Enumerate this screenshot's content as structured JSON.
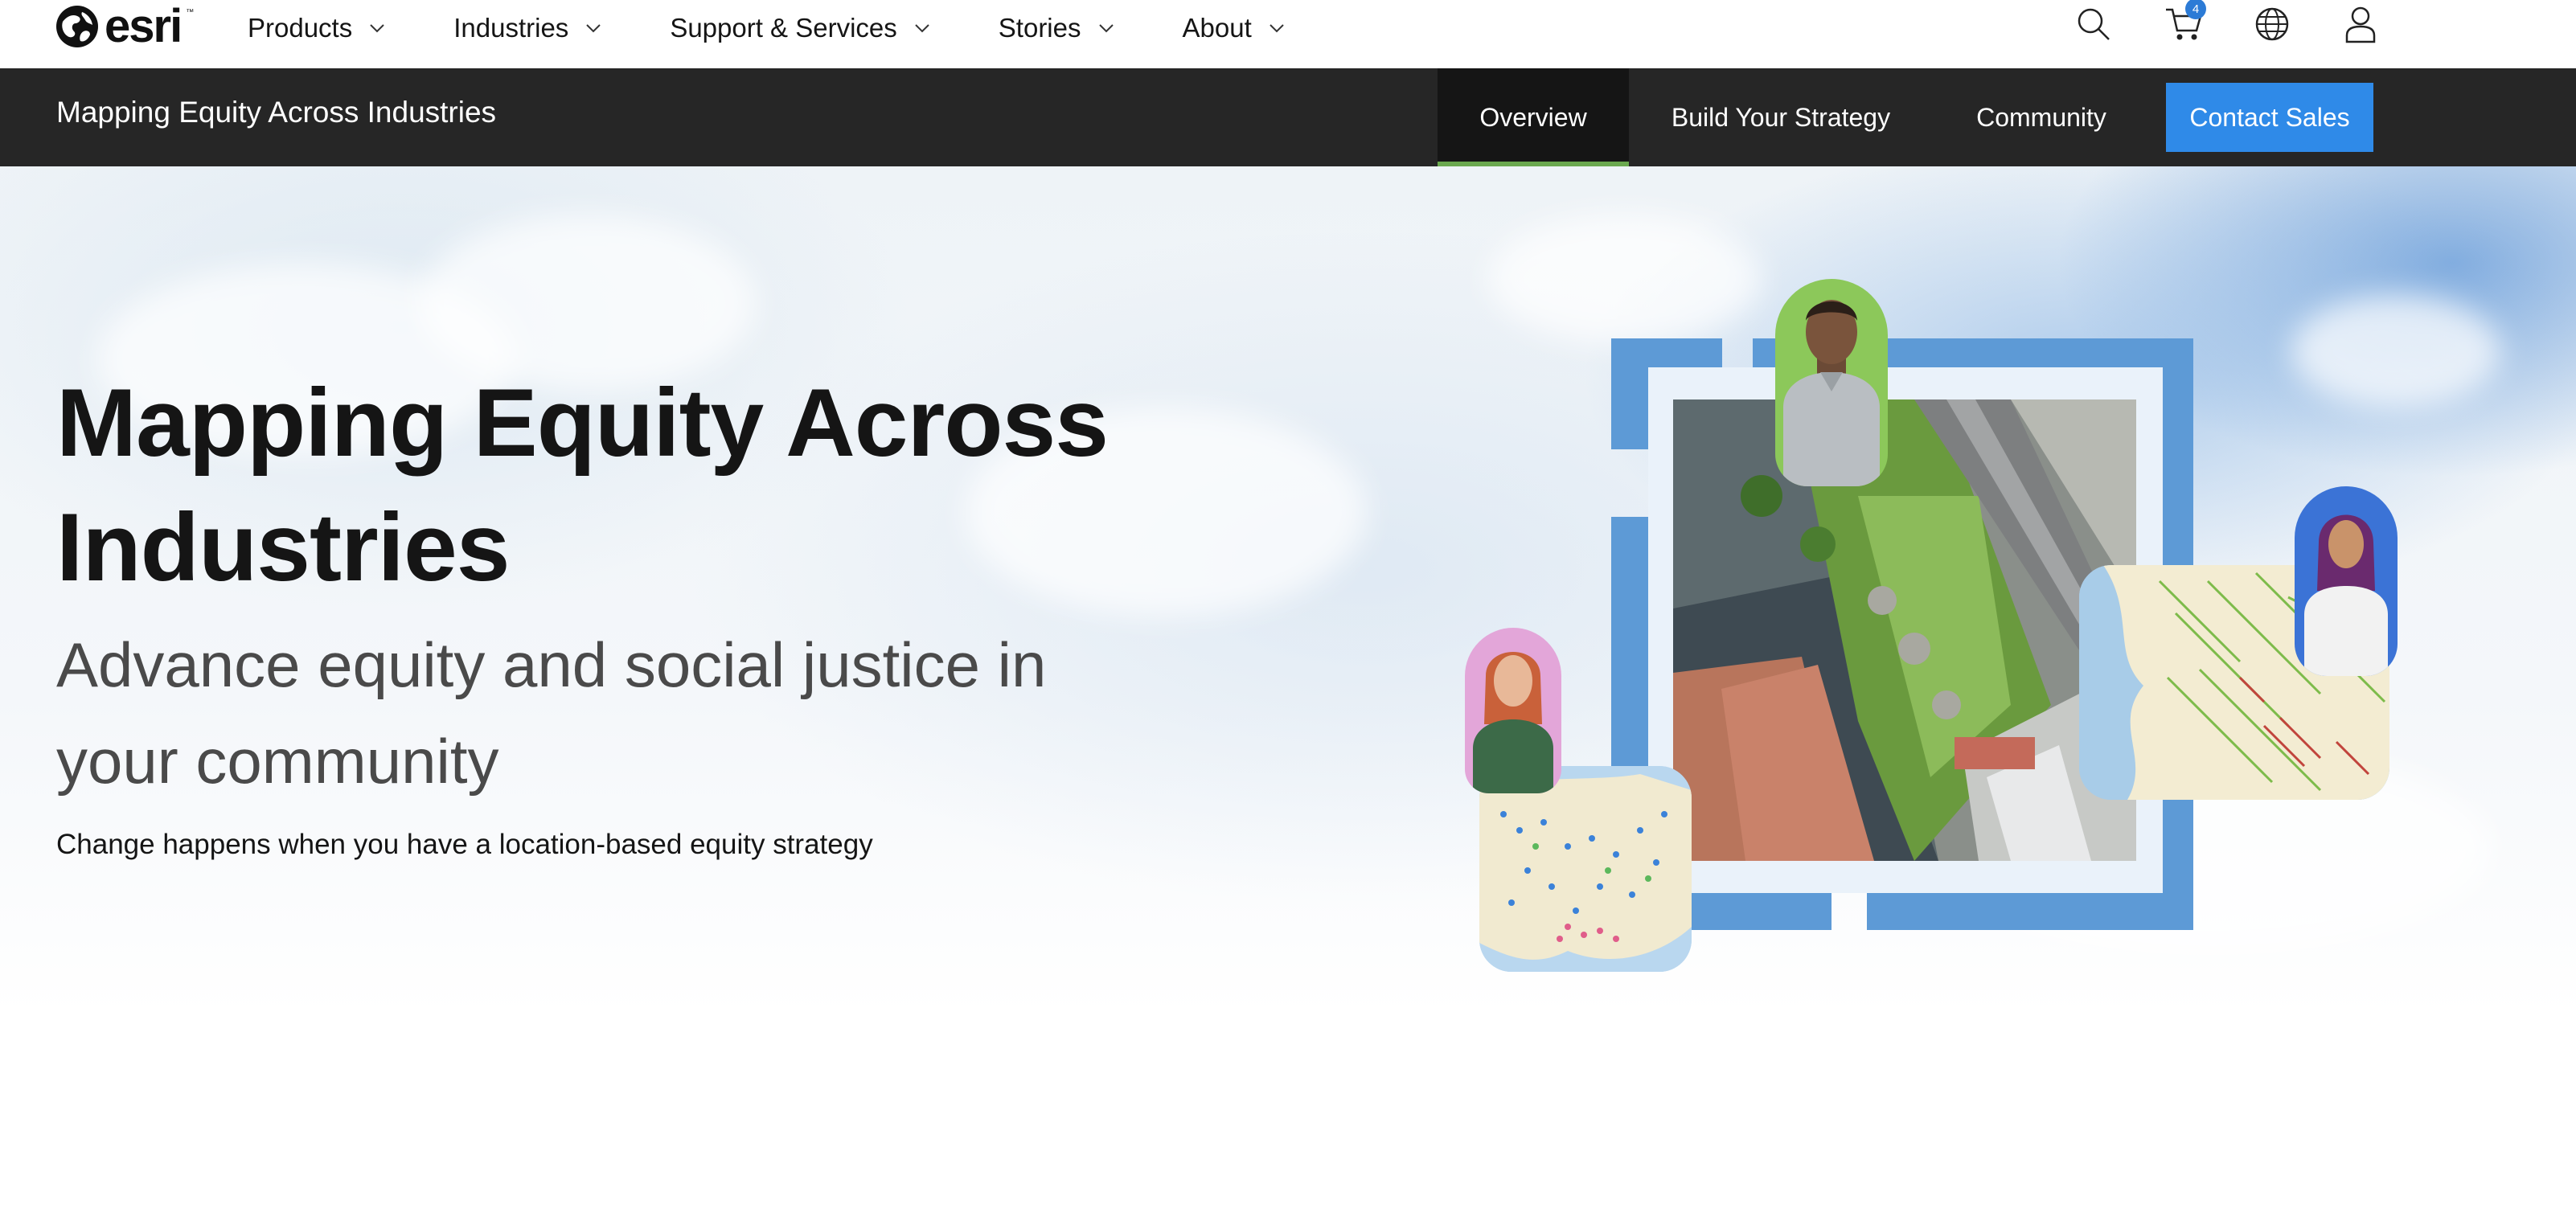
{
  "brand": {
    "logo_text": "esri",
    "logo_tm": "™"
  },
  "global_nav": {
    "items": [
      {
        "label": "Products"
      },
      {
        "label": "Industries"
      },
      {
        "label": "Support & Services"
      },
      {
        "label": "Stories"
      },
      {
        "label": "About"
      }
    ],
    "cart_count": "4"
  },
  "local_nav": {
    "title": "Mapping Equity Across Industries",
    "links": [
      {
        "label": "Overview",
        "active": true
      },
      {
        "label": "Build Your Strategy",
        "active": false
      },
      {
        "label": "Community",
        "active": false
      }
    ],
    "cta": "Contact Sales"
  },
  "hero": {
    "title": "Mapping Equity Across Industries",
    "subtitle": "Advance equity and social justice in your community",
    "body": "Change happens when you have a location-based equity strategy"
  },
  "colors": {
    "accent_blue": "#2f8ae8",
    "active_underline": "#6aa84f",
    "local_nav_bg": "#262626",
    "frame_blue": "#5d9ad6"
  }
}
